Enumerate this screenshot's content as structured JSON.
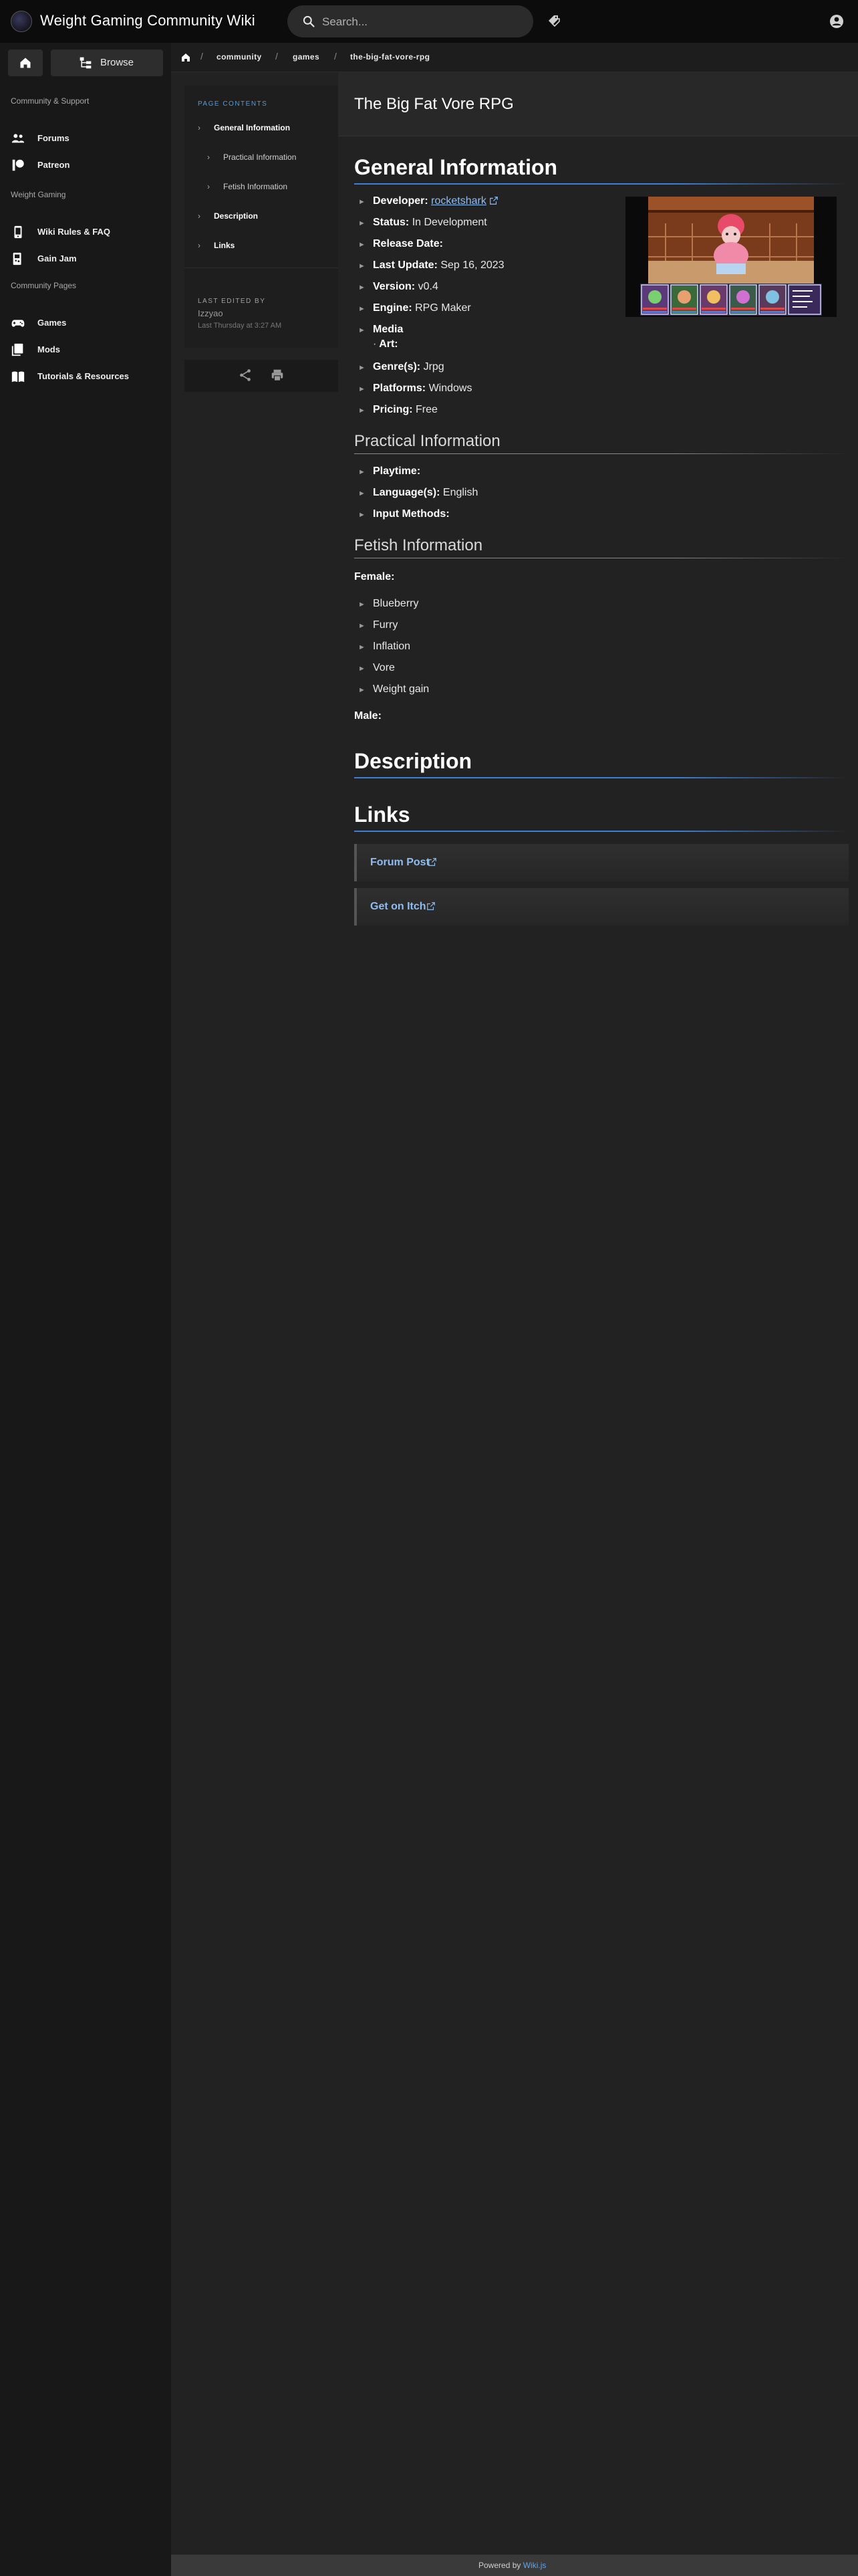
{
  "header": {
    "site_title": "Weight Gaming Community Wiki",
    "search_placeholder": "Search...",
    "icons": [
      "logo",
      "search-icon",
      "tags-icon",
      "account-icon"
    ]
  },
  "leftnav": {
    "home_icon": "home-icon",
    "browse_label": "Browse",
    "sections": [
      {
        "header": "Community & Support",
        "items": [
          {
            "label": "Forums",
            "icon": "people-icon"
          },
          {
            "label": "Patreon",
            "icon": "patreon-icon"
          }
        ]
      },
      {
        "header": "Weight Gaming",
        "items": [
          {
            "label": "Wiki Rules & FAQ",
            "icon": "phone-rules-icon"
          },
          {
            "label": "Gain Jam",
            "icon": "gamepad-icon"
          }
        ]
      },
      {
        "header": "Community Pages",
        "items": [
          {
            "label": "Games",
            "icon": "controller-icon"
          },
          {
            "label": "Mods",
            "icon": "mods-icon"
          },
          {
            "label": "Tutorials & Resources",
            "icon": "book-icon"
          }
        ]
      }
    ]
  },
  "breadcrumb": [
    "community",
    "games",
    "the-big-fat-vore-rpg"
  ],
  "page": {
    "title": "The Big Fat Vore RPG"
  },
  "toc": {
    "title": "PAGE CONTENTS",
    "items": [
      {
        "label": "General Information",
        "level": 1
      },
      {
        "label": "Practical Information",
        "level": 2
      },
      {
        "label": "Fetish Information",
        "level": 2
      },
      {
        "label": "Description",
        "level": 1
      },
      {
        "label": "Links",
        "level": 1
      }
    ]
  },
  "last_edited": {
    "header": "LAST EDITED BY",
    "user": "Izzyao",
    "date": "Last Thursday at 3:27 AM"
  },
  "general": {
    "heading": "General Information",
    "developer_label": "Developer:",
    "developer_value": "rocketshark",
    "status_label": "Status:",
    "status_value": "In Development",
    "release_label": "Release Date:",
    "release_value": "",
    "update_label": "Last Update:",
    "update_value": "Sep 16, 2023",
    "version_label": "Version:",
    "version_value": "v0.4",
    "engine_label": "Engine:",
    "engine_value": "RPG Maker",
    "media_label": "Media",
    "art_label": "Art:",
    "genre_label": "Genre(s):",
    "genre_value": "Jrpg",
    "platforms_label": "Platforms:",
    "platforms_value": "Windows",
    "pricing_label": "Pricing:",
    "pricing_value": "Free"
  },
  "practical": {
    "heading": "Practical Information",
    "playtime_label": "Playtime:",
    "language_label": "Language(s):",
    "language_value": "English",
    "input_label": "Input Methods:"
  },
  "fetish": {
    "heading": "Fetish Information",
    "female_label": "Female:",
    "female_items": [
      "Blueberry",
      "Furry",
      "Inflation",
      "Vore",
      "Weight gain"
    ],
    "male_label": "Male:"
  },
  "description": {
    "heading": "Description"
  },
  "links": {
    "heading": "Links",
    "items": [
      "Forum Post",
      "Get on Itch"
    ]
  },
  "footer": {
    "powered_by": "Powered by",
    "engine": "Wiki.js"
  },
  "colors": {
    "accent": "#3d7fd6",
    "link": "#8fbdf0",
    "background": "#222222",
    "sidebar": "#181818",
    "topbar": "#0c0c0c"
  }
}
